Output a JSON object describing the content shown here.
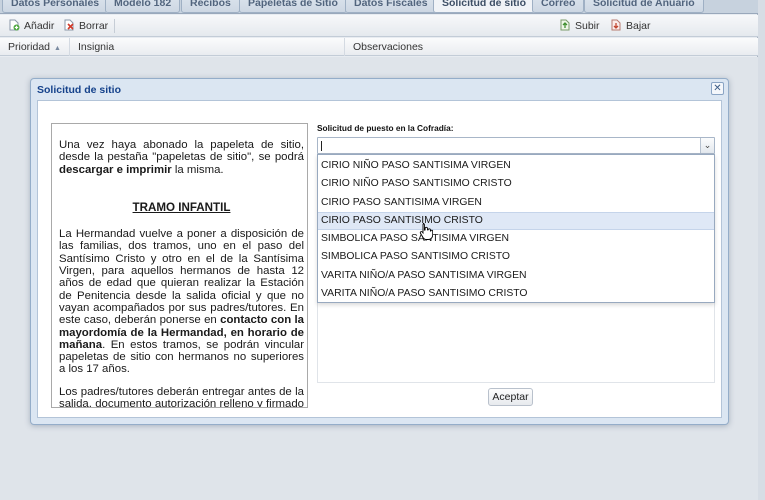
{
  "tabs": [
    {
      "label": "Datos Personales"
    },
    {
      "label": "Modelo 182"
    },
    {
      "label": "Recibos"
    },
    {
      "label": "Papeletas de Sitio"
    },
    {
      "label": "Datos Fiscales"
    },
    {
      "label": "Solicitud de sitio",
      "active": true
    },
    {
      "label": "Correo"
    },
    {
      "label": "Solicitud de Anuario"
    }
  ],
  "toolbar": {
    "add_label": "Añadir",
    "delete_label": "Borrar",
    "up_label": "Subir",
    "down_label": "Bajar"
  },
  "grid": {
    "columns": [
      "Prioridad",
      "Insignia",
      "Observaciones"
    ]
  },
  "dialog": {
    "title": "Solicitud de sitio",
    "close_icon": "close-icon",
    "info": {
      "p1_text": "Una vez haya abonado la papeleta de sitio, desde la pestaña \"papeletas de sitio\", se podrá ",
      "p1_bold": "descargar e imprimir",
      "p1_end": " la misma.",
      "section_title": "TRAMO INFANTIL",
      "p2_text": "La Hermandad vuelve a poner a disposición de las familias, dos tramos, uno en el paso del Santísimo Cristo y otro en el de la Santísima Virgen, para aquellos hermanos de hasta 12 años de edad que quieran realizar la Estación de Penitencia desde la salida oficial y que no vayan acompañados por sus padres/tutores. En este caso, deberán ponerse en ",
      "p2_bold": "contacto con la mayordomía de la Hermandad, en horario de mañana",
      "p2_end": ". En estos tramos, se podrán vincular papeletas de sitio con hermanos no superiores a los 17 años.",
      "p3_text": "Los padres/tutores deberán entregar antes de la salida, documento autorización relleno y firmado (documento proporcionado en la Hermandad)."
    },
    "field_label": "Solicitud de puesto en la Cofradía:",
    "combo_value": "",
    "options": [
      "CIRIO NIÑO PASO SANTISIMA VIRGEN",
      "CIRIO NIÑO PASO SANTISIMO CRISTO",
      "CIRIO PASO SANTISIMA VIRGEN",
      "CIRIO PASO SANTISIMO CRISTO",
      "SIMBOLICA PASO SANTISIMA VIRGEN",
      "SIMBOLICA PASO SANTISIMO CRISTO",
      "VARITA NIÑO/A PASO SANTISIMA VIRGEN",
      "VARITA NIÑO/A PASO SANTISIMO CRISTO"
    ],
    "highlighted_option_index": 3,
    "accept_label": "Aceptar"
  }
}
